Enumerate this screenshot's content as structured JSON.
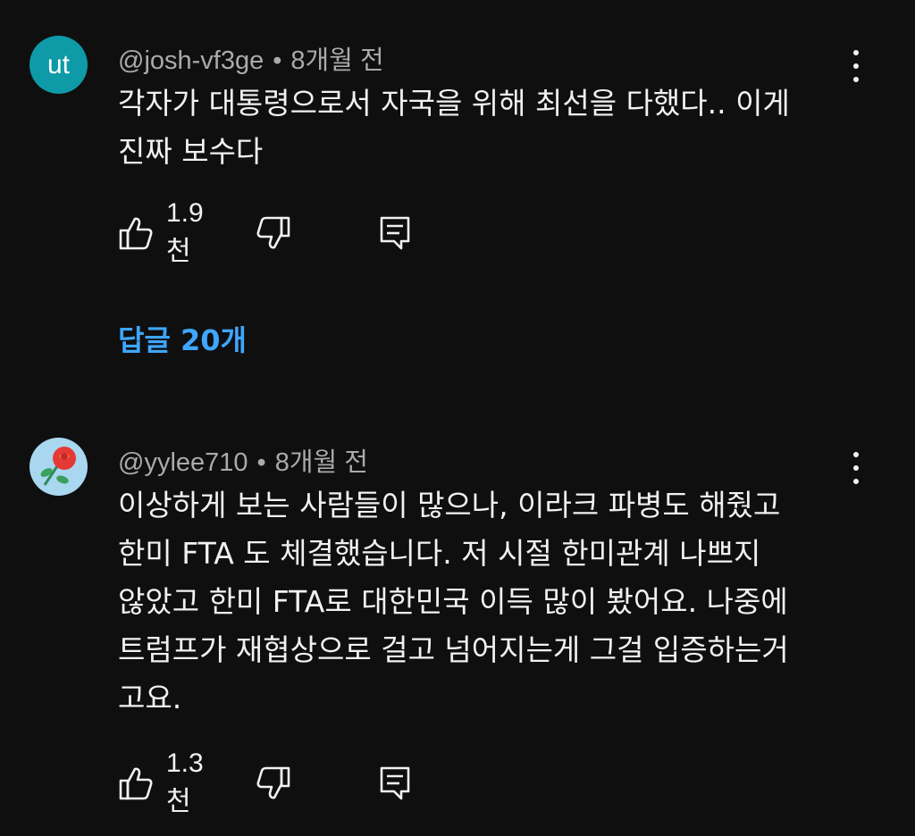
{
  "comments": [
    {
      "avatar_initials": "ut",
      "avatar_color": "#0f9aa8",
      "author": "@josh-vf3ge",
      "separator": "•",
      "time": "8개월 전",
      "text_lines": [
        "각자가 대통령으로서 자국을 위해 최선을 다했다.. 이게",
        "진짜 보수다"
      ],
      "like_count": "1.9천",
      "icons": [
        "thumbs-up-icon",
        "thumbs-down-icon",
        "reply-icon",
        "more-vert-icon"
      ]
    },
    {
      "avatar_icon": "rose-icon",
      "avatar_color": "#a9d7f0",
      "author": "@yylee710",
      "separator": "•",
      "time": "8개월 전",
      "text_lines": [
        "이상하게 보는 사람들이 많으나, 이라크 파병도 해줬고",
        "한미 FTA 도 체결했습니다. 저 시절 한미관계 나쁘지",
        "않았고 한미 FTA로 대한민국 이득 많이 봤어요. 나중에",
        "트럼프가 재협상으로 걸고 넘어지는게 그걸 입증하는거",
        "고요."
      ],
      "like_count": "1.3천",
      "icons": [
        "thumbs-up-icon",
        "thumbs-down-icon",
        "reply-icon",
        "more-vert-icon"
      ]
    }
  ],
  "replies_link": "답글 20개",
  "colors": {
    "background": "#0f0f0f",
    "text": "#f1f1f1",
    "meta": "#aaaaaa",
    "link": "#3ea6ff"
  }
}
